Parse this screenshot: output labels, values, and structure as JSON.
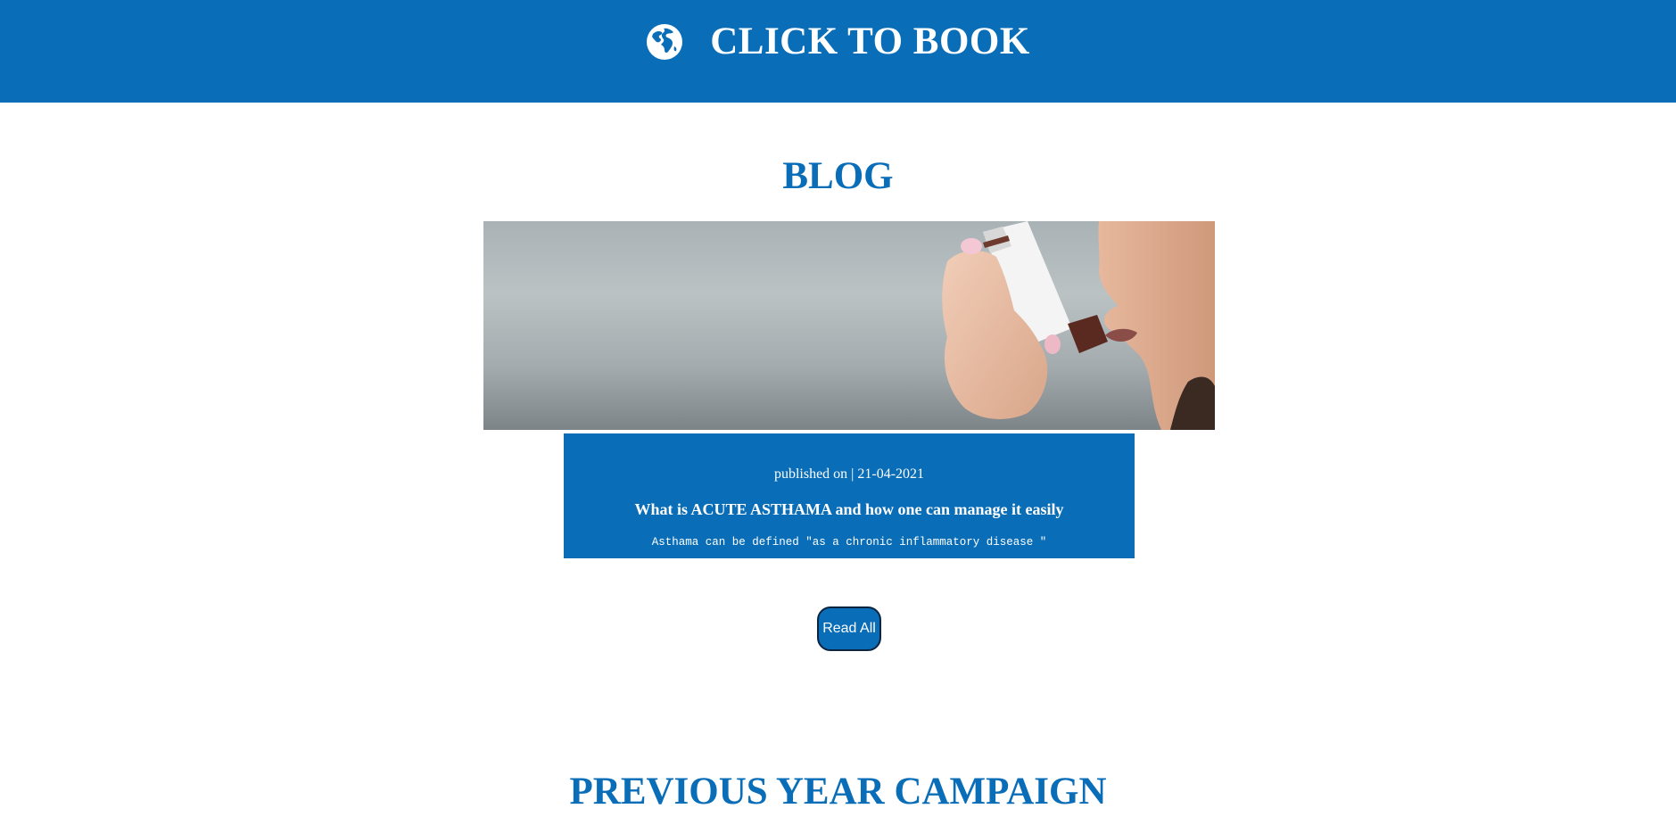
{
  "header": {
    "book_label": "CLICK TO BOOK",
    "icon": "globe-icon",
    "background_color": "#0a6db8"
  },
  "blog": {
    "title": "BLOG",
    "image_alt": "woman-using-asthma-inhaler",
    "post": {
      "published_label": "published on | 21-04-2021",
      "title": "What is ACUTE ASTHAMA and how one can manage it easily",
      "excerpt": "Asthama can be defined \"as a chronic inflammatory disease \""
    },
    "read_all_label": "Read All"
  },
  "campaign": {
    "title": "PREVIOUS YEAR CAMPAIGN"
  },
  "colors": {
    "accent": "#0a6db8",
    "button_border": "#0b2540",
    "text_on_accent": "#ffffff"
  }
}
